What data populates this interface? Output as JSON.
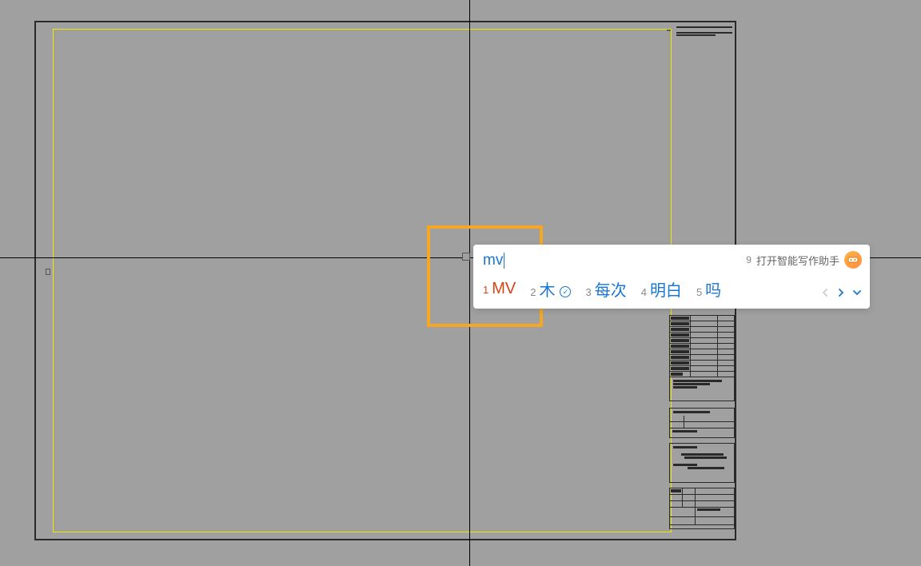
{
  "ime": {
    "input": "mv",
    "assistant": {
      "num": "9",
      "label": "打开智能写作助手"
    },
    "candidates": [
      {
        "num": "1",
        "text": "MV",
        "selected": true,
        "cloud": false
      },
      {
        "num": "2",
        "text": "木",
        "selected": false,
        "cloud": true
      },
      {
        "num": "3",
        "text": "每次",
        "selected": false,
        "cloud": false
      },
      {
        "num": "4",
        "text": "明白",
        "selected": false,
        "cloud": false
      },
      {
        "num": "5",
        "text": "吗",
        "selected": false,
        "cloud": false
      }
    ]
  }
}
